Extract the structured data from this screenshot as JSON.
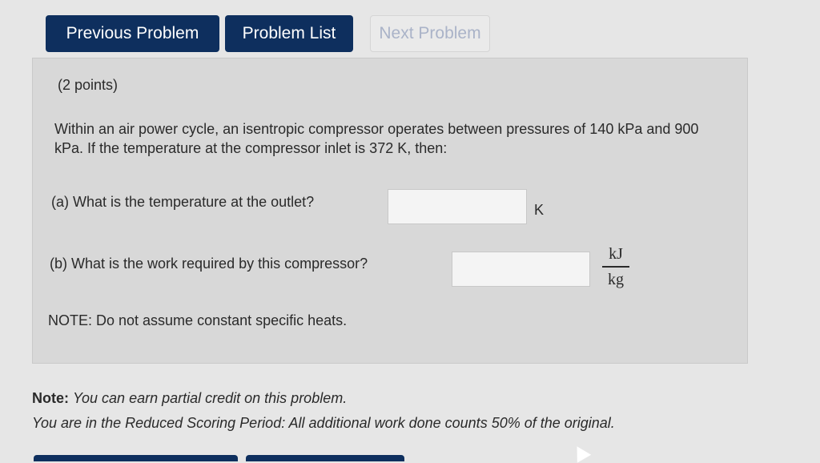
{
  "nav": {
    "previous": "Previous Problem",
    "list": "Problem List",
    "next": "Next Problem"
  },
  "problem": {
    "points": "(2 points)",
    "statement": "Within an air power cycle, an isentropic compressor operates between pressures of 140 kPa and 900 kPa. If the temperature at the compressor inlet is 372 K, then:",
    "part_a": "(a) What is the temperature at the outlet?",
    "part_a_unit": "K",
    "part_a_value": "",
    "part_b": "(b) What is the work required by this compressor?",
    "part_b_unit_num": "kJ",
    "part_b_unit_den": "kg",
    "part_b_value": "",
    "note": "NOTE: Do not assume constant specific heats."
  },
  "footer": {
    "note_label": "Note:",
    "note_text": "You can earn partial credit on this problem.",
    "scoring": "You are in the Reduced Scoring Period: All additional work done counts 50% of the original."
  },
  "colors": {
    "button_bg": "#0e2f5e",
    "button_text": "#ffffff",
    "disabled_text": "#aab3c8"
  }
}
